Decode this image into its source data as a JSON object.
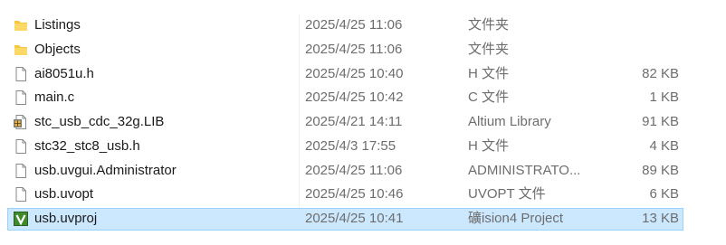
{
  "files": [
    {
      "name": "Listings",
      "modified": "2025/4/25 11:06",
      "type": "文件夹",
      "size": "",
      "icon": "folder-icon"
    },
    {
      "name": "Objects",
      "modified": "2025/4/25 11:06",
      "type": "文件夹",
      "size": "",
      "icon": "folder-icon"
    },
    {
      "name": "ai8051u.h",
      "modified": "2025/4/25 10:40",
      "type": "H 文件",
      "size": "82 KB",
      "icon": "file-icon"
    },
    {
      "name": "main.c",
      "modified": "2025/4/25 10:42",
      "type": "C 文件",
      "size": "1 KB",
      "icon": "file-icon"
    },
    {
      "name": "stc_usb_cdc_32g.LIB",
      "modified": "2025/4/21 14:11",
      "type": "Altium Library",
      "size": "91 KB",
      "icon": "library-file-icon"
    },
    {
      "name": "stc32_stc8_usb.h",
      "modified": "2025/4/3 17:55",
      "type": "H 文件",
      "size": "4 KB",
      "icon": "file-icon"
    },
    {
      "name": "usb.uvgui.Administrator",
      "modified": "2025/4/25 11:06",
      "type": "ADMINISTRATO...",
      "size": "89 KB",
      "icon": "file-icon"
    },
    {
      "name": "usb.uvopt",
      "modified": "2025/4/25 10:46",
      "type": "UVOPT 文件",
      "size": "6 KB",
      "icon": "file-icon"
    },
    {
      "name": "usb.uvproj",
      "modified": "2025/4/25 10:41",
      "type": "礦ision4 Project",
      "size": "13 KB",
      "icon": "uvision-project-icon",
      "selected": true
    }
  ],
  "colors": {
    "selection_bg": "#cce8ff",
    "selection_border": "#99d1ff",
    "folder": "#f8c73e",
    "uvision": "#3f8a2a"
  }
}
